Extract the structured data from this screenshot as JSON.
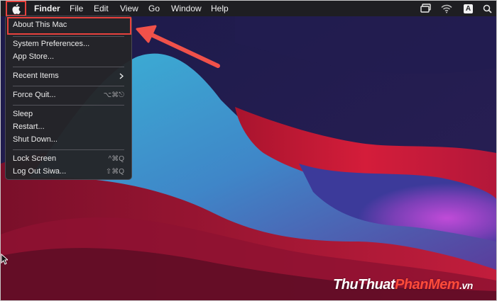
{
  "menubar": {
    "app_name": "Finder",
    "menus": [
      "File",
      "Edit",
      "View",
      "Go",
      "Window",
      "Help"
    ],
    "status_icons": [
      "display-icon",
      "wifi-icon",
      "input-source-icon",
      "spotlight-icon"
    ],
    "input_source_letter": "A"
  },
  "apple_menu": {
    "items": [
      {
        "label": "About This Mac",
        "shortcut": ""
      },
      {
        "label": "System Preferences...",
        "shortcut": ""
      },
      {
        "label": "App Store...",
        "shortcut": ""
      },
      {
        "label": "Recent Items",
        "shortcut": ""
      },
      {
        "label": "Force Quit...",
        "shortcut": "⌥⌘⎋"
      },
      {
        "label": "Sleep",
        "shortcut": ""
      },
      {
        "label": "Restart...",
        "shortcut": ""
      },
      {
        "label": "Shut Down...",
        "shortcut": ""
      },
      {
        "label": "Lock Screen",
        "shortcut": "^⌘Q"
      },
      {
        "label": "Log Out Siwa...",
        "shortcut": "⇧⌘Q"
      }
    ]
  },
  "watermark": {
    "part1": "ThuThuat",
    "part2": "PhanMem",
    "part3": ".vn"
  },
  "colors": {
    "highlight": "#e8413d",
    "menubar_bg": "#1e1e22",
    "menu_bg": "#242428"
  }
}
